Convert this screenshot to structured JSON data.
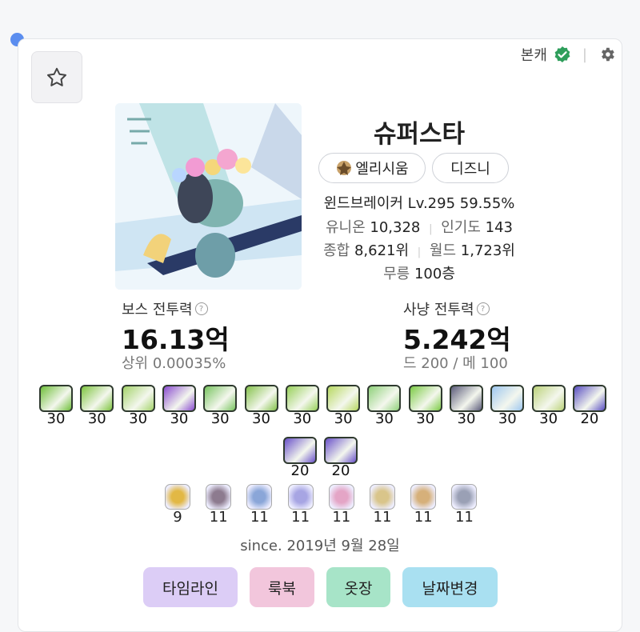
{
  "header": {
    "main_char_label": "본캐",
    "verified_color": "#2e9e5b"
  },
  "character": {
    "name": "슈퍼스타",
    "guild": "엘리시움",
    "world": "디즈니",
    "job_level": "윈드브레이커 Lv.295 59.55%",
    "union_label": "유니온",
    "union_value": "10,328",
    "pop_label": "인기도",
    "pop_value": "143",
    "overall_label": "종합",
    "overall_value": "8,621위",
    "world_rank_label": "월드",
    "world_rank_value": "1,723위",
    "mureung_label": "무릉",
    "mureung_value": "100층"
  },
  "stats": {
    "boss_label": "보스 전투력",
    "boss_value": "16.13억",
    "boss_sub": "상위 0.00035%",
    "hunt_label": "사냥 전투력",
    "hunt_value": "5.242억",
    "hunt_sub": "드 200 / 메 100"
  },
  "skills_row1": [
    {
      "lv": "30",
      "color": "#6fbf3a"
    },
    {
      "lv": "30",
      "color": "#7ec43f"
    },
    {
      "lv": "30",
      "color": "#a4d36a"
    },
    {
      "lv": "30",
      "color": "#8a4ccf"
    },
    {
      "lv": "30",
      "color": "#79c460"
    },
    {
      "lv": "30",
      "color": "#86c24c"
    },
    {
      "lv": "30",
      "color": "#98d05a"
    },
    {
      "lv": "30",
      "color": "#b7d860"
    },
    {
      "lv": "30",
      "color": "#8fd17a"
    },
    {
      "lv": "30",
      "color": "#7ccb45"
    },
    {
      "lv": "30",
      "color": "#5b5b7a"
    },
    {
      "lv": "30",
      "color": "#9ec7ef"
    },
    {
      "lv": "30",
      "color": "#bcd27a"
    },
    {
      "lv": "20",
      "color": "#5a4fc2"
    }
  ],
  "skills_row2": [
    {
      "lv": "20",
      "color": "#6a52c9"
    },
    {
      "lv": "20",
      "color": "#6a52c9"
    }
  ],
  "symbols": [
    {
      "lv": "9",
      "color": "#e2b845"
    },
    {
      "lv": "11",
      "color": "#8d7b8f"
    },
    {
      "lv": "11",
      "color": "#8aa6d8"
    },
    {
      "lv": "11",
      "color": "#a7a5e3"
    },
    {
      "lv": "11",
      "color": "#e4a5c6"
    },
    {
      "lv": "11",
      "color": "#d9c58a"
    },
    {
      "lv": "11",
      "color": "#d6b07a"
    },
    {
      "lv": "11",
      "color": "#9aa0b5"
    }
  ],
  "since": "since. 2019년 9월 28일",
  "buttons": {
    "timeline": "타임라인",
    "lookbook": "룩북",
    "closet": "옷장",
    "change_date": "날짜변경"
  }
}
